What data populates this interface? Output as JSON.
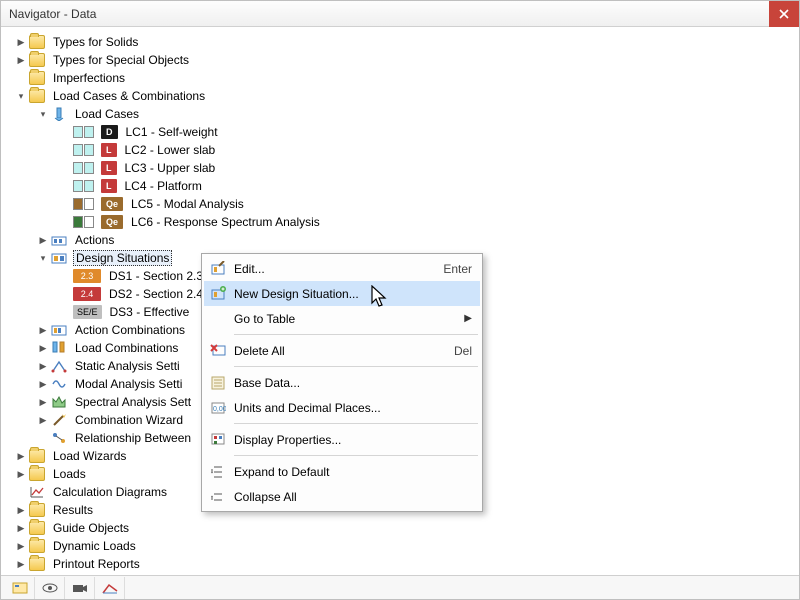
{
  "window": {
    "title": "Navigator - Data"
  },
  "colors": {
    "badge_black": "#1a1a1a",
    "badge_red": "#c43a3a",
    "badge_brown": "#9a6b2d",
    "badge_green": "#3b7a3b",
    "ds_orange": "#e08a2b",
    "ds_red": "#c43a3a",
    "ds_grey": "#bfbfbf",
    "lc_cyan": "#bff1ef"
  },
  "tree": {
    "types_solids": "Types for Solids",
    "types_special": "Types for Special Objects",
    "imperfections": "Imperfections",
    "lcac": "Load Cases & Combinations",
    "load_cases": "Load Cases",
    "lc1": {
      "badge": "D",
      "label": "LC1 - Self-weight"
    },
    "lc2": {
      "badge": "L",
      "label": "LC2 - Lower slab"
    },
    "lc3": {
      "badge": "L",
      "label": "LC3 - Upper slab"
    },
    "lc4": {
      "badge": "L",
      "label": "LC4 - Platform"
    },
    "lc5": {
      "badge": "Qe",
      "label": "LC5 - Modal Analysis"
    },
    "lc6": {
      "badge": "Qe",
      "label": "LC6 - Response Spectrum Analysis"
    },
    "actions": "Actions",
    "design_situations": "Design Situations",
    "ds1": {
      "badge": "2.3",
      "label": "DS1 - Section 2.3"
    },
    "ds2": {
      "badge": "2.4",
      "label": "DS2 - Section 2.4"
    },
    "ds3": {
      "badge": "SE/E",
      "label": "DS3 - Effective "
    },
    "action_comb": "Action Combinations",
    "load_comb": "Load Combinations",
    "static_analysis": "Static Analysis Setti",
    "modal_analysis": "Modal Analysis Setti",
    "spectral_analysis": "Spectral Analysis Sett",
    "combo_wizard": "Combination Wizard",
    "rel_between": "Relationship Between",
    "load_wizards": "Load Wizards",
    "loads": "Loads",
    "calc_diagrams": "Calculation Diagrams",
    "results": "Results",
    "guide_objects": "Guide Objects",
    "dynamic_loads": "Dynamic Loads",
    "printout_reports": "Printout Reports"
  },
  "context_menu": {
    "edit": {
      "label": "Edit...",
      "shortcut": "Enter"
    },
    "new_ds": {
      "label": "New Design Situation..."
    },
    "goto_table": {
      "label": "Go to Table"
    },
    "delete_all": {
      "label": "Delete All",
      "shortcut": "Del"
    },
    "base_data": {
      "label": "Base Data..."
    },
    "units": {
      "label": "Units and Decimal Places..."
    },
    "display_props": {
      "label": "Display Properties..."
    },
    "expand": {
      "label": "Expand to Default"
    },
    "collapse": {
      "label": "Collapse All"
    }
  }
}
